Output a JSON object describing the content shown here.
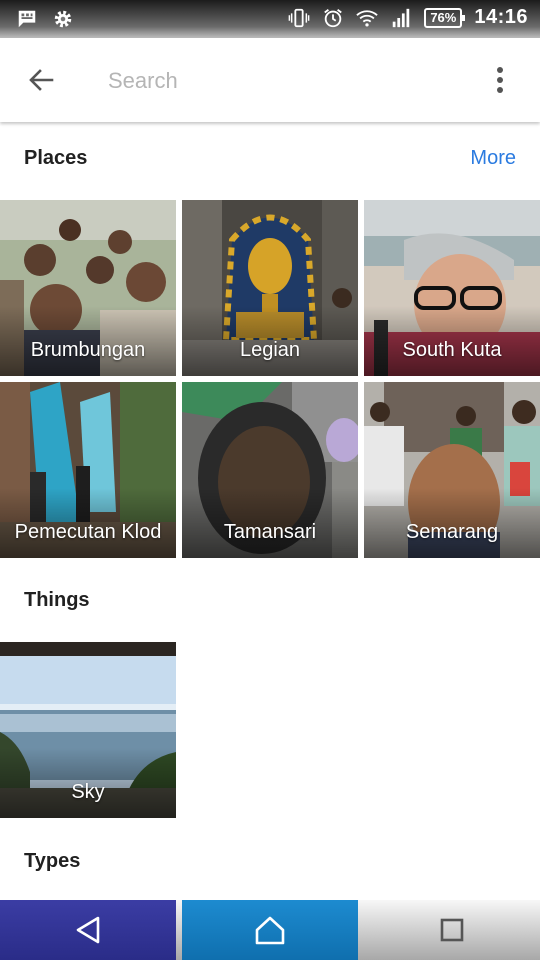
{
  "status_bar": {
    "left_icons": [
      "message-icon",
      "settings-gear-icon"
    ],
    "right_icons": [
      "vibrate-icon",
      "alarm-icon",
      "wifi-icon",
      "signal-icon"
    ],
    "battery": "76%",
    "time": "14:16"
  },
  "toolbar": {
    "back_icon": "arrow-back-icon",
    "search_placeholder": "Search",
    "overflow_icon": "more-vert-icon"
  },
  "places": {
    "title": "Places",
    "more_label": "More",
    "items": [
      {
        "label": "Brumbungan"
      },
      {
        "label": "Legian"
      },
      {
        "label": "South Kuta"
      },
      {
        "label": "Pemecutan Klod"
      },
      {
        "label": "Tamansari"
      },
      {
        "label": "Semarang"
      }
    ]
  },
  "things": {
    "title": "Things",
    "items": [
      {
        "label": "Sky"
      }
    ]
  },
  "types": {
    "title": "Types"
  },
  "nav_bar": {
    "back_icon": "nav-back-icon",
    "home_icon": "nav-home-icon",
    "recent_icon": "nav-recents-icon"
  }
}
